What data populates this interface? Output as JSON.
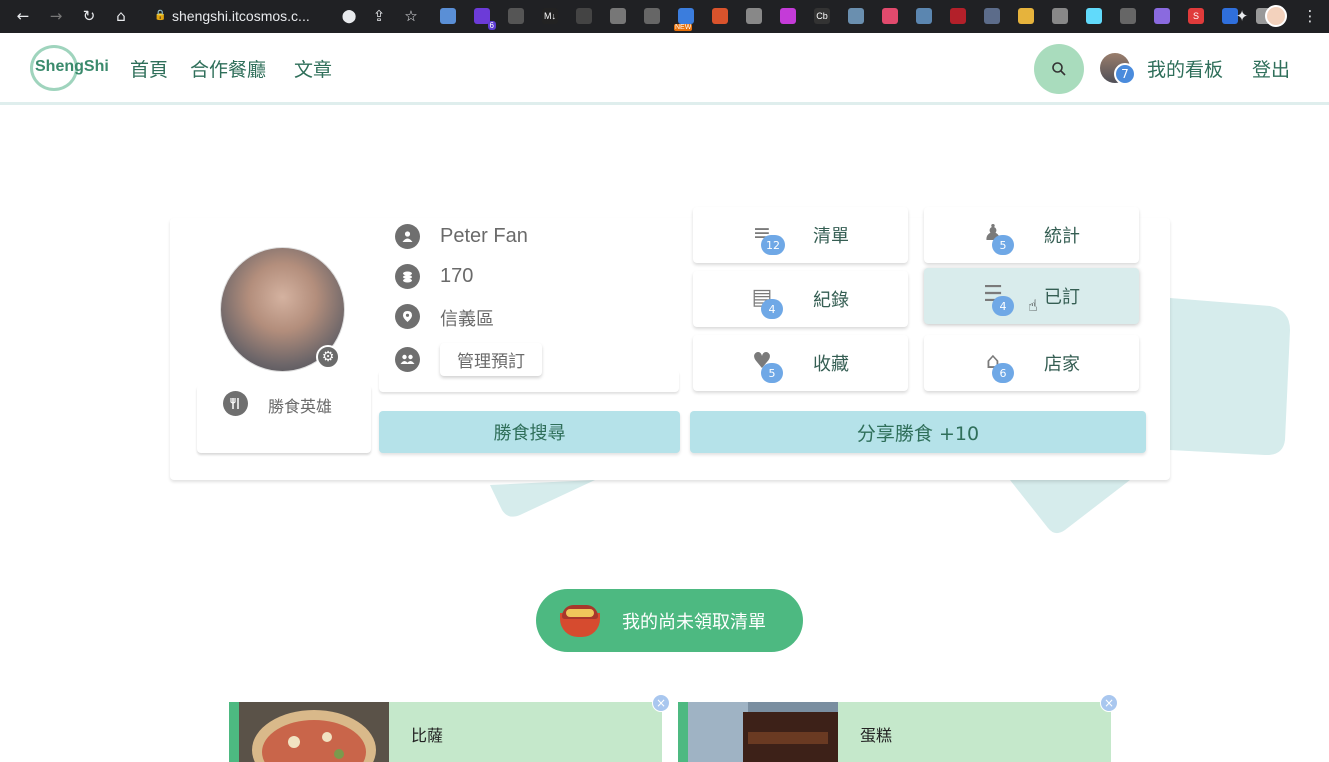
{
  "browser": {
    "url": "shengshi.itcosmos.c...",
    "extensions": [
      {
        "name": "tampermonkey-icon",
        "color": "#5a8fd6"
      },
      {
        "name": "extension-6-icon",
        "color": "#6c3bd8",
        "badge": "6"
      },
      {
        "name": "line-icon",
        "color": "#555"
      },
      {
        "name": "markdown-icon",
        "color": "#222",
        "text": "M↓"
      },
      {
        "name": "camera-icon",
        "color": "#444"
      },
      {
        "name": "screenshot-icon",
        "color": "#777"
      },
      {
        "name": "crop-icon",
        "color": "#666"
      },
      {
        "name": "new-extension-icon",
        "color": "#3b7ddd",
        "new": "NEW"
      },
      {
        "name": "fire-icon",
        "color": "#d9532c"
      },
      {
        "name": "pen-icon",
        "color": "#888"
      },
      {
        "name": "color-wheel-icon",
        "color": "#c43bd8"
      },
      {
        "name": "cb-icon",
        "color": "#333",
        "text": "Cb"
      },
      {
        "name": "circle-icon",
        "color": "#6a8faf"
      },
      {
        "name": "pocket-icon",
        "color": "#e14a6d"
      },
      {
        "name": "image-icon",
        "color": "#5b86b0"
      },
      {
        "name": "pin-icon",
        "color": "#b3202a"
      },
      {
        "name": "square-icon",
        "color": "#5c6c8a"
      },
      {
        "name": "chrome-icon",
        "color": "#e6b33c"
      },
      {
        "name": "settings-ext-icon",
        "color": "#888"
      },
      {
        "name": "react-icon",
        "color": "#61dafb"
      },
      {
        "name": "move-icon",
        "color": "#666"
      },
      {
        "name": "feather-icon",
        "color": "#8a6adf"
      },
      {
        "name": "s-icon",
        "color": "#e03b3b",
        "text": "S"
      },
      {
        "name": "blue-dot-icon",
        "color": "#2f6fdc"
      },
      {
        "name": "qr-icon",
        "color": "#999"
      }
    ]
  },
  "header": {
    "logo": "ShengShi",
    "nav": [
      "首頁",
      "合作餐廳",
      "文章"
    ],
    "user_badge": "7",
    "board_label": "我的看板",
    "logout_label": "登出"
  },
  "profile": {
    "name": "Peter Fan",
    "points": "170",
    "district": "信義區",
    "manage_label": "管理預訂",
    "title": "勝食英雄"
  },
  "tiles": [
    {
      "label": "清單",
      "badge": "12",
      "icon": "list-icon"
    },
    {
      "label": "統計",
      "badge": "5",
      "icon": "stats-icon"
    },
    {
      "label": "紀錄",
      "badge": "4",
      "icon": "archive-icon"
    },
    {
      "label": "已訂",
      "badge": "4",
      "icon": "reserved-icon"
    },
    {
      "label": "收藏",
      "badge": "5",
      "icon": "heart-icon"
    },
    {
      "label": "店家",
      "badge": "6",
      "icon": "store-icon"
    }
  ],
  "actions": {
    "search_label": "勝食搜尋",
    "share_label": "分享勝食 +10"
  },
  "pending": {
    "label": "我的尚未領取清單"
  },
  "foods": [
    {
      "name": "比薩"
    },
    {
      "name": "蛋糕"
    }
  ]
}
